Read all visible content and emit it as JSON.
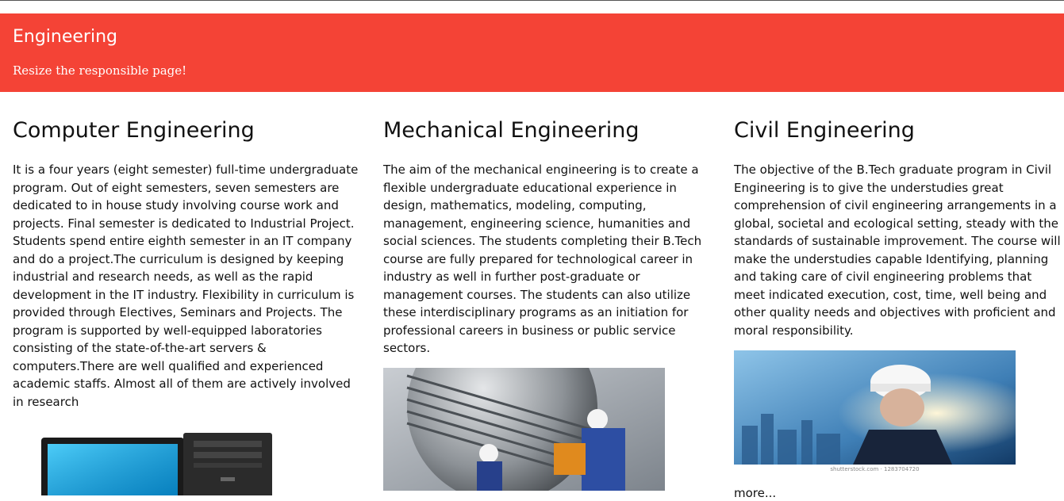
{
  "header": {
    "title": "Engineering",
    "subtitle": "Resize the responsible page!",
    "background": "#f44336"
  },
  "sections": [
    {
      "title": "Computer Engineering",
      "text": "It is a four years (eight semester) full-time undergraduate program. Out of eight semesters, seven semesters are dedicated to in house study involving course work and projects. Final semester is dedicated to Industrial Project. Students spend entire eighth semester in an IT company and do a project.The curriculum is designed by keeping industrial and research needs, as well as the rapid development in the IT industry. Flexibility in curriculum is provided through Electives, Seminars and Projects. The program is supported by well-equipped laboratories consisting of the state-of-the-art servers & computers.There are well qualified and experienced academic staffs. Almost all of them are actively involved in research",
      "image": "desktop-computer-image"
    },
    {
      "title": "Mechanical Engineering",
      "text": "The aim of the mechanical engineering is to create a flexible undergraduate educational experience in design, mathematics, modeling, computing, management, engineering science, humanities and social sciences. The students completing their B.Tech course are fully prepared for technological career in industry as well in further post-graduate or management courses. The students can also utilize these interdisciplinary programs as an initiation for professional careers in business or public service sectors.",
      "image": "turbine-workers-image"
    },
    {
      "title": "Civil Engineering",
      "text": "The objective of the B.Tech graduate program in Civil Engineering is to give the understudies great comprehension of civil engineering arrangements in a global, societal and ecological setting, steady with the standards of sustainable improvement. The course will make the understudies capable Identifying, planning and taking care of civil engineering problems that meet indicated execution, cost, time, well being and other quality needs and objectives with proficient and moral responsibility.",
      "image": "engineer-hardhat-city-image",
      "image_caption": "shutterstock.com · 1283704720"
    }
  ],
  "more_label": "more..."
}
